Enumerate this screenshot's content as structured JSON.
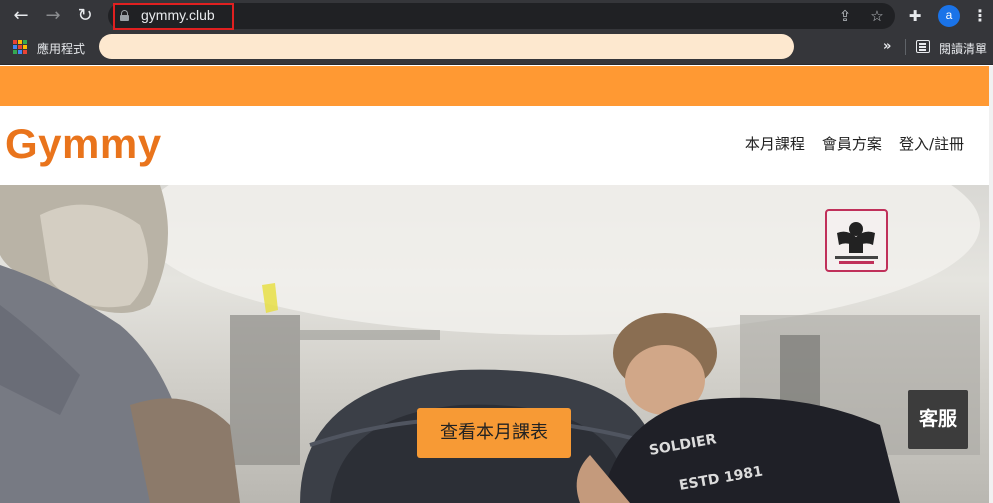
{
  "browser": {
    "url": "gymmy.club",
    "profile_initial": "a",
    "bookmarks": {
      "apps_label": "應用程式",
      "more_label": "»",
      "reading_list_label": "閱讀清單"
    }
  },
  "site": {
    "logo": "Gymmy",
    "nav": [
      {
        "label": "本月課程"
      },
      {
        "label": "會員方案"
      },
      {
        "label": "登入/註冊"
      }
    ]
  },
  "hero": {
    "cta_label": "查看本月課表",
    "service_label": "客服"
  },
  "colors": {
    "accent": "#ff9933",
    "logo": "#e9741c",
    "cta": "#f79a35",
    "highlight": "#e02020"
  }
}
